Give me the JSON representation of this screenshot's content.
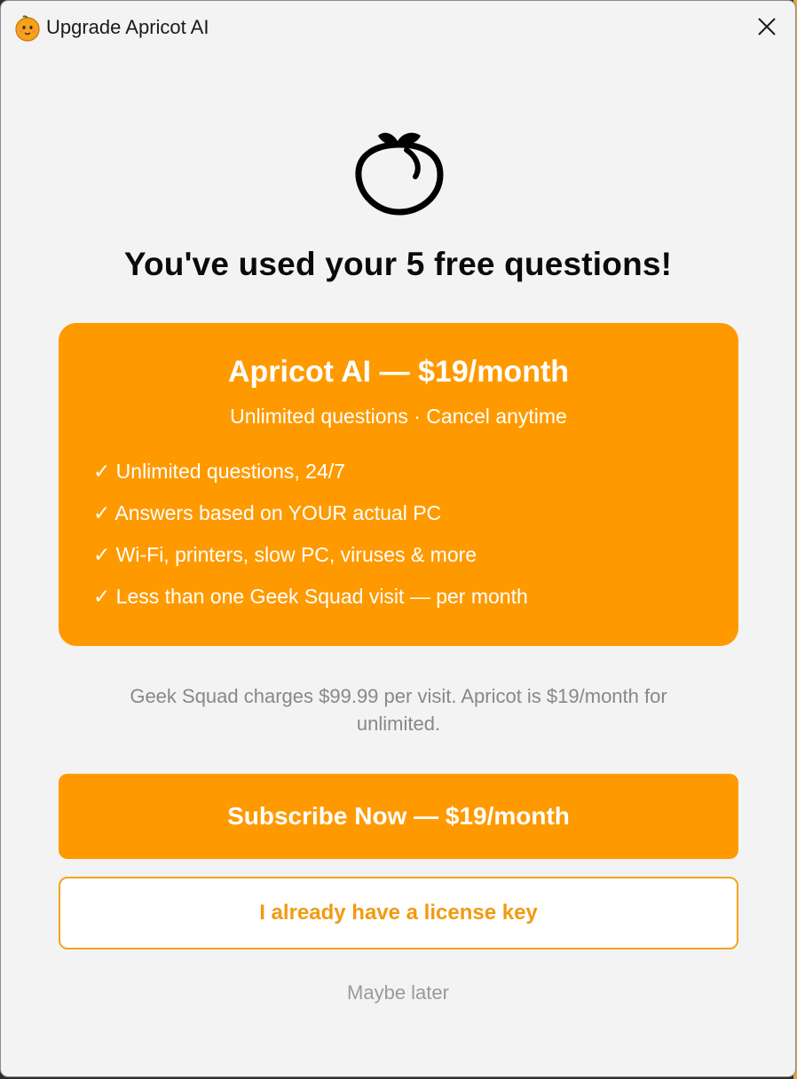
{
  "window": {
    "title": "Upgrade Apricot AI",
    "app_icon": "apricot-face-icon",
    "close_icon": "close-icon"
  },
  "header": {
    "icon": "peach-outline-icon",
    "headline": "You've used your 5 free questions!"
  },
  "plan": {
    "title": "Apricot AI — $19/month",
    "subtitle": "Unlimited questions · Cancel anytime",
    "features": [
      "✓ Unlimited questions, 24/7",
      "✓ Answers based on YOUR actual PC",
      "✓ Wi-Fi, printers, slow PC, viruses & more",
      "✓ Less than one Geek Squad visit — per month"
    ]
  },
  "note": "Geek Squad charges $99.99 per visit. Apricot is $19/month for unlimited.",
  "actions": {
    "subscribe_label": "Subscribe Now — $19/month",
    "license_label": "I already have a license key",
    "later_label": "Maybe later"
  },
  "colors": {
    "accent": "#fe9a00",
    "window_bg": "#f3f3f3",
    "muted_text": "#888888"
  }
}
